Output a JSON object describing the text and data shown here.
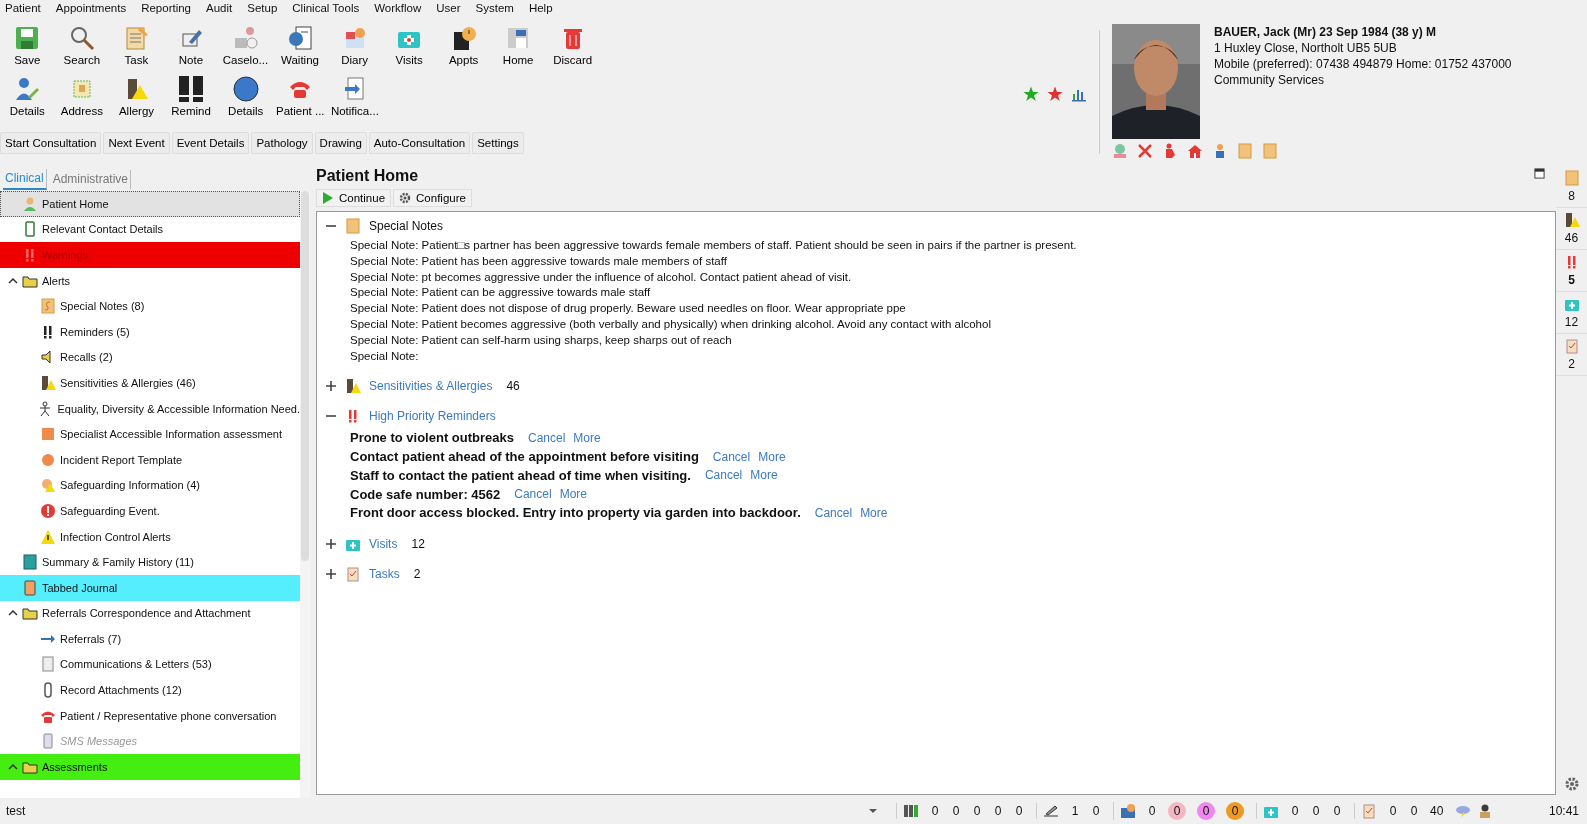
{
  "menu": [
    "Patient",
    "Appointments",
    "Reporting",
    "Audit",
    "Setup",
    "Clinical Tools",
    "Workflow",
    "User",
    "System",
    "Help"
  ],
  "toolbar_rows": [
    [
      "Save",
      "Search",
      "Task",
      "Note",
      "Caselo...",
      "Waiting",
      "Diary",
      "Visits",
      "Appts",
      "Home",
      "Discard"
    ],
    [
      "Details",
      "Address",
      "Allergy",
      "Remind",
      "Details",
      "Patient ...",
      "Notifica..."
    ]
  ],
  "action_tabs": [
    "Start Consultation",
    "Next Event",
    "Event Details",
    "Pathology",
    "Drawing",
    "Auto-Consultation",
    "Settings"
  ],
  "patient": {
    "name": "BAUER, Jack (Mr) 23 Sep 1984 (38 y) M",
    "lines": [
      "1 Huxley Close, Northolt UB5 5UB",
      "Mobile (preferred): 07438 494879 Home: 01752 437000",
      "Community Services"
    ]
  },
  "stars": [
    {
      "color": "#22aa22"
    },
    {
      "color": "#e03030"
    }
  ],
  "sidebar": {
    "tabs": [
      {
        "label": "Clinical",
        "selected": true
      },
      {
        "label": "Administrative",
        "selected": false
      }
    ],
    "items": [
      {
        "label": "Patient Home",
        "selected": true,
        "disabled": false
      },
      {
        "label": "Relevant Contact Details",
        "selected": false,
        "disabled": false
      },
      {
        "label": "Warnings",
        "selected": false,
        "disabled": false,
        "color": "#ee0000"
      },
      {
        "label": "Alerts",
        "selected": false,
        "disabled": false,
        "expanded": true,
        "children": [
          {
            "label": "Special Notes (8)",
            "selected": false,
            "disabled": false
          },
          {
            "label": "Reminders (5)",
            "selected": false,
            "disabled": false
          },
          {
            "label": "Recalls (2)",
            "selected": false,
            "disabled": false
          },
          {
            "label": "Sensitivities & Allergies (46)",
            "selected": false,
            "disabled": false
          },
          {
            "label": "Equality, Diversity & Accessible Information Need.",
            "selected": false,
            "disabled": false
          },
          {
            "label": "Specialist Accessible Information assessment",
            "selected": false,
            "disabled": false
          },
          {
            "label": "Incident Report Template",
            "selected": false,
            "disabled": false
          },
          {
            "label": "Safeguarding Information (4)",
            "selected": false,
            "disabled": false
          },
          {
            "label": "Safeguarding Event.",
            "selected": false,
            "disabled": false
          },
          {
            "label": "Infection Control Alerts",
            "selected": false,
            "disabled": false
          }
        ]
      },
      {
        "label": "Summary & Family History (11)",
        "selected": false,
        "disabled": false
      },
      {
        "label": "Tabbed Journal",
        "selected": false,
        "disabled": false,
        "color": "#55eeff"
      },
      {
        "label": "Referrals Correspondence and Attachment",
        "selected": false,
        "disabled": false,
        "expanded": true,
        "children": [
          {
            "label": "Referrals (7)",
            "selected": false,
            "disabled": false
          },
          {
            "label": "Communications & Letters (53)",
            "selected": false,
            "disabled": false
          },
          {
            "label": "Record Attachments (12)",
            "selected": false,
            "disabled": false
          },
          {
            "label": "Patient / Representative phone conversation",
            "selected": false,
            "disabled": false
          },
          {
            "label": "SMS Messages",
            "selected": false,
            "disabled": true
          }
        ]
      },
      {
        "label": "Assessments",
        "selected": false,
        "disabled": false,
        "expanded": true,
        "color": "#44ee11"
      }
    ]
  },
  "content": {
    "title": "Patient Home",
    "buttons": [
      "Continue",
      "Configure"
    ],
    "sections": [
      {
        "kind": "notes",
        "title": "Special Notes",
        "expanded": true,
        "lines": [
          "Special Note: Patient□s partner has been aggressive towards female members of staff. Patient should be seen in pairs if the partner is present.",
          "Special Note: Patient has been aggressive towards male members of staff",
          "Special Note: pt becomes aggressive under the influence of alcohol. Contact patient ahead of visit.",
          "Special Note: Patient can be aggressive towards male staff",
          "Special Note: Patient does not dispose of drug properly. Beware used needles on floor. Wear appropriate ppe",
          "Special Note: Patient becomes aggressive (both verbally and physically) when drinking alcohol. Avoid any contact with alcohol",
          "Special Note: Patient can self-harm using sharps, keep sharps out of reach",
          "Special Note:"
        ]
      },
      {
        "kind": "count",
        "title": "Sensitivities & Allergies",
        "count": "46",
        "expanded": false
      },
      {
        "kind": "reminders",
        "title": "High Priority Reminders",
        "expanded": true,
        "reminders": [
          {
            "text": "Prone to violent outbreaks",
            "actions": [
              "Cancel",
              "More"
            ]
          },
          {
            "text": "Contact patient ahead of the appointment before visiting",
            "actions": [
              "Cancel",
              "More"
            ]
          },
          {
            "text": "Staff to contact the patient ahead of time when visiting.",
            "actions": [
              "Cancel",
              "More"
            ]
          },
          {
            "text": "Code safe number: 4562",
            "actions": [
              "Cancel",
              "More"
            ]
          },
          {
            "text": "Front door access blocked. Entry into property via garden into backdoor.",
            "actions": [
              "Cancel",
              "More"
            ]
          }
        ]
      },
      {
        "kind": "count",
        "title": "Visits",
        "count": "12",
        "expanded": false
      },
      {
        "kind": "count",
        "title": "Tasks",
        "count": "2",
        "expanded": false
      }
    ]
  },
  "side_counts": [
    {
      "count": "8",
      "bold": false
    },
    {
      "count": "46",
      "bold": false
    },
    {
      "count": "5",
      "bold": true
    },
    {
      "count": "12",
      "bold": false
    },
    {
      "count": "2",
      "bold": false
    }
  ],
  "status_bar": {
    "text": "test",
    "groups": [
      [
        {
          "value": "0"
        },
        {
          "value": "0"
        },
        {
          "value": "0"
        },
        {
          "value": "0"
        },
        {
          "value": "0"
        }
      ],
      [
        {
          "value": "1"
        },
        {
          "value": "0"
        }
      ],
      [
        {
          "value": "0"
        },
        {
          "value": "0",
          "color": "#f4b6c2"
        },
        {
          "value": "0",
          "color": "#ee88ee"
        },
        {
          "value": "0",
          "color": "#ee9922"
        }
      ],
      [
        {
          "value": "0"
        },
        {
          "value": "0"
        },
        {
          "value": "0"
        }
      ],
      [
        {
          "value": "0"
        },
        {
          "value": "0"
        },
        {
          "value": "40"
        }
      ]
    ],
    "time": "10:41"
  }
}
